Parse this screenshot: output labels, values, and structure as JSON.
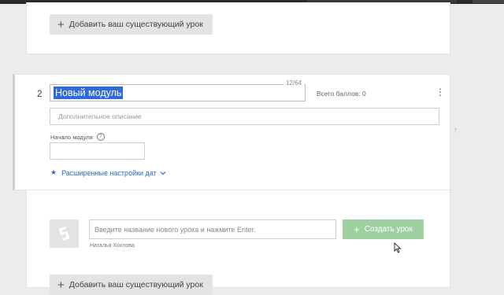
{
  "top": {
    "add_existing_label": "Добавить ваш существующий урок"
  },
  "module": {
    "number": "2",
    "title": "Новый модуль",
    "char_counter": "12/64",
    "total_points": "Всего баллов: 0",
    "description_placeholder": "Дополнительное описание",
    "start_label": "Начало модуля",
    "start_value": "",
    "advanced_dates_label": "Расширенные настройки дат"
  },
  "lessons": {
    "new_lesson_placeholder": "Введите название нового урока и нажмите Enter.",
    "author": "Наталья Хохлова",
    "create_button_label": "Создать урок",
    "add_existing_label": "Добавить ваш существующий урок"
  },
  "icons": {
    "plus": "plus-icon",
    "kebab": "more-vertical-icon",
    "help": "help-circle-icon",
    "star": "star-icon",
    "chevron": "chevron-down-icon",
    "arrow_up": "arrow-up-icon",
    "avatar": "logo-placeholder-icon",
    "cursor": "mouse-cursor-icon"
  },
  "colors": {
    "accent_link": "#2a6cc8",
    "selection": "#2f6bd8",
    "create_button": "#9ed0a0"
  }
}
